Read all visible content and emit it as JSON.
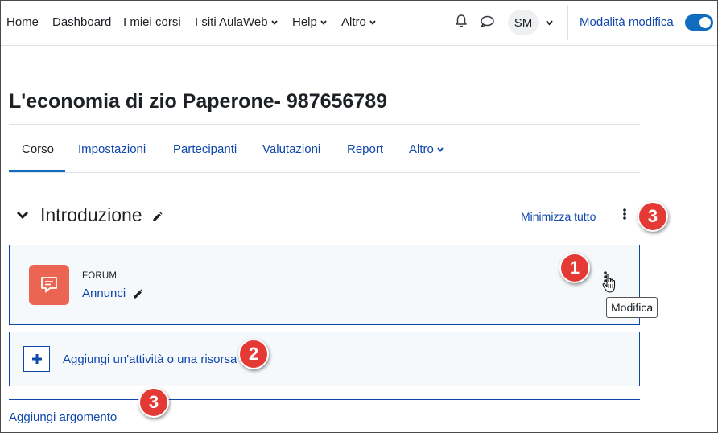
{
  "navbar": {
    "items": [
      {
        "label": "Home",
        "dropdown": false
      },
      {
        "label": "Dashboard",
        "dropdown": false
      },
      {
        "label": "I miei corsi",
        "dropdown": false
      },
      {
        "label": "I siti AulaWeb",
        "dropdown": true
      },
      {
        "label": "Help",
        "dropdown": true
      },
      {
        "label": "Altro",
        "dropdown": true
      }
    ],
    "icons": [
      "bell-icon",
      "chat-bubble-icon"
    ],
    "user_initials": "SM",
    "edit_mode_label": "Modalità modifica",
    "edit_mode_on": true
  },
  "course": {
    "title": "L'economia di zio Paperone- 987656789"
  },
  "tabs": [
    {
      "label": "Corso",
      "active": true
    },
    {
      "label": "Impostazioni",
      "active": false
    },
    {
      "label": "Partecipanti",
      "active": false
    },
    {
      "label": "Valutazioni",
      "active": false
    },
    {
      "label": "Report",
      "active": false
    },
    {
      "label": "Altro",
      "active": false,
      "dropdown": true
    }
  ],
  "section": {
    "title": "Introduzione",
    "collapse_all_label": "Minimizza tutto",
    "activity": {
      "type_label": "FORUM",
      "name": "Annunci",
      "icon": "forum-icon",
      "icon_color": "#eb6552"
    },
    "add_activity_label": "Aggiungi un'attività o una risorsa",
    "add_topic_label": "Aggiungi argomento"
  },
  "tooltip": {
    "text": "Modifica"
  },
  "callouts": [
    "1",
    "2",
    "3",
    "3"
  ],
  "colors": {
    "link": "#0f47ad",
    "accent": "#0f6cbf",
    "callout": "#e53935"
  }
}
